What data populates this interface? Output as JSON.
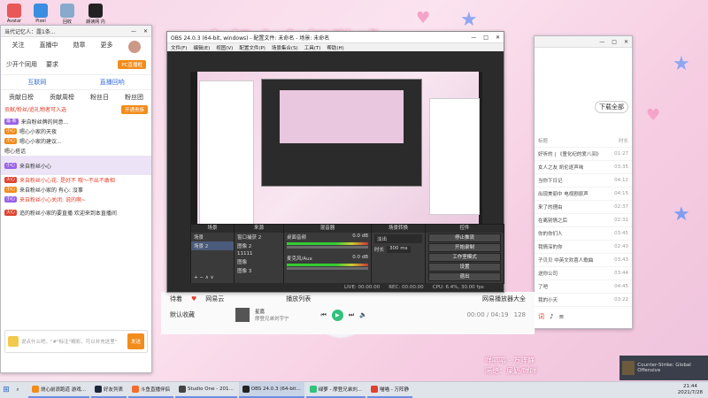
{
  "desktop": {
    "banner": "卡机上车打游戏",
    "icons": [
      "Avatar",
      "Pixel",
      "回收",
      "朗读网 内容"
    ],
    "overlay_lines": [
      "咩喵喵 - 万阵静",
      "隔绝：尿奶/咩咩"
    ]
  },
  "left_panel": {
    "title": "当代记忆人：露1条...",
    "nav": [
      "关注",
      "直播中",
      "勋章",
      "更多"
    ],
    "actions": [
      "少开个同用",
      "要求"
    ],
    "pc_button": "PC直播框",
    "tabs": [
      "互联网",
      "直播回响"
    ],
    "sub_tabs": [
      "贡献日榜",
      "贡献周榜",
      "粉丝日",
      "粉丝团"
    ],
    "rank_line": "贡献/粉丝/追礼物者可入选",
    "rank_button": "开通贵族",
    "messages": [
      {
        "tag": "最·新",
        "text": "来自粉丝牌的同意..."
      },
      {
        "tag": "小心",
        "text": "嗯心小家的天夜"
      },
      {
        "tag": "小心",
        "text": "嗯心小家的建议..."
      },
      {
        "tag": "",
        "text": "嗯心搭话"
      },
      {
        "tag": "小心",
        "text": "来自粉丝小心"
      },
      {
        "tag": "火心",
        "text": "来自粉丝小心花: 是好不 哦～不出不敢相"
      },
      {
        "tag": "小心",
        "text": "来自粉丝小家的 有心: 沒事"
      },
      {
        "tag": "小心",
        "text": "来自粉丝小心关闭: 说的啊~"
      },
      {
        "tag": "火心",
        "text": "追的粉丝小家的要直播 欢迎来到本直播间"
      }
    ],
    "input_placeholder": "说点什么吧，\"#\"标注\"精彩，可以补充这里\"",
    "send_label": "发送"
  },
  "obs": {
    "title": "OBS 24.0.3 (64-bit, windows) - 配置文件: 未命名 - 场景: 未命名",
    "menu": [
      "文件(F)",
      "编辑(E)",
      "视图(V)",
      "配置文件(P)",
      "场景集合(S)",
      "工具(T)",
      "帮助(H)"
    ],
    "docks": {
      "scenes": {
        "header": "场景",
        "items": [
          "场景",
          "场景 2"
        ]
      },
      "sources": {
        "header": "来源",
        "items": [
          "窗口捕获 2",
          "图像 2",
          "11111",
          "图像",
          "图像 3"
        ]
      },
      "mixer": {
        "header": "混音器",
        "channels": [
          {
            "name": "桌面音频",
            "level": "0.0 dB"
          },
          {
            "name": "麦克风/Aux",
            "level": "0.0 dB"
          }
        ]
      },
      "transitions": {
        "header": "场景转换",
        "type": "淡出",
        "duration_label": "时长",
        "duration": "300 ms"
      },
      "controls": {
        "header": "控件",
        "buttons": [
          "停止推流",
          "开始录制",
          "工作室模式",
          "设置",
          "退出"
        ]
      }
    },
    "status": {
      "live": "LIVE: 00:00:00",
      "rec": "REC: 00:00:00",
      "cpu": "CPU: 6.4%, 30.00 fps"
    }
  },
  "music": {
    "download_all": "下载全部",
    "header_title": "标题",
    "header_time": "时长",
    "songs": [
      {
        "title": "好听的 | 《童化纪的爱八间》",
        "time": "01:27"
      },
      {
        "title": "女人之友 凯伦逐声味",
        "time": "03:35"
      },
      {
        "title": "当你下日记",
        "time": "04:12"
      },
      {
        "title": "出现美丽中 电视剧原声",
        "time": "04:15"
      },
      {
        "title": "来了的理由",
        "time": "02:37"
      },
      {
        "title": "在离别情之后",
        "time": "02:31"
      },
      {
        "title": "你的你们人",
        "time": "03:45"
      },
      {
        "title": "我情深的你",
        "time": "02:40"
      },
      {
        "title": "子贝贝 中英文欢喜人歌曲",
        "time": "03:43"
      },
      {
        "title": "送你公司",
        "time": "03:44"
      },
      {
        "title": "了吧",
        "time": "04:45"
      },
      {
        "title": "我的小天",
        "time": "03:22"
      }
    ],
    "player_tabs": [
      "待着",
      "默认收藏"
    ],
    "playlist_label": "播放列表",
    "user_name": "网易云",
    "track_title": "星嘉",
    "track_artist": "摩登兄弟刘宇宁",
    "progress_time": "00:00 / 04:19",
    "progress_fraction": 0.0,
    "lyric_label": "词",
    "count": "128",
    "source_label": "查看原",
    "ad_label": "网易播放器大全"
  },
  "tray_app": {
    "name": "Counter-Strike: Global Offensive"
  },
  "taskbar": {
    "tasks": [
      "烧心前浪跑道 游戏...",
      "好友列表",
      "斗鱼直播伴侣",
      "Studio One - 201...",
      "OBS 24.0.3 (64-bit...",
      "绿萝 - 摩登兄弟刘...",
      "喵喵 - 万阵静"
    ],
    "clock": "21:44",
    "date": "2021/7/28"
  },
  "colors": {
    "accent": "#f28c1c",
    "obs_bg": "#2b2b2b",
    "taskbar_accent": "#6a8de0",
    "play_green": "#31c27c"
  }
}
